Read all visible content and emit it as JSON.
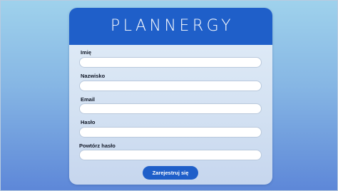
{
  "brand": {
    "logo_text": "PLANNERGY"
  },
  "form": {
    "fields": [
      {
        "label": "Imię",
        "value": "",
        "placeholder": ""
      },
      {
        "label": "Nazwisko",
        "value": "",
        "placeholder": ""
      },
      {
        "label": "Email",
        "value": "",
        "placeholder": ""
      },
      {
        "label": "Hasło",
        "value": "",
        "placeholder": ""
      },
      {
        "label": "Powtórz hasło",
        "value": "",
        "placeholder": ""
      }
    ],
    "submit_label": "Zarejestruj się"
  },
  "colors": {
    "accent": "#1f5fc9",
    "card_background": "#dce8f5",
    "input_background": "#ffffff",
    "page_background_top": "#9fd2ec",
    "page_background_bottom": "#5d87d8"
  }
}
